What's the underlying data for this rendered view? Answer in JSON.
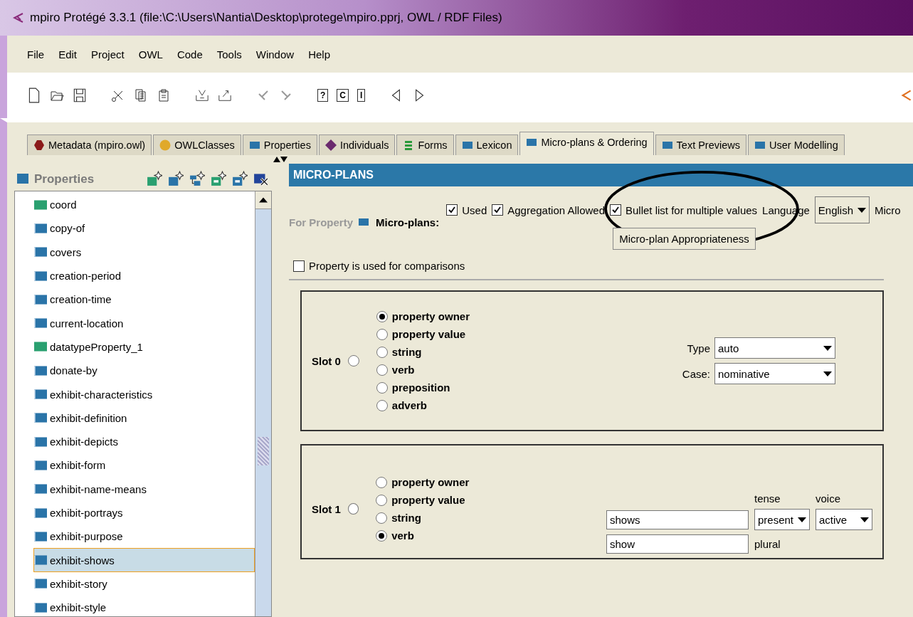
{
  "window": {
    "title": "mpiro  Protégé 3.3.1     (file:\\C:\\Users\\Nantia\\Desktop\\protege\\mpiro.pprj, OWL / RDF Files)"
  },
  "menu": [
    "File",
    "Edit",
    "Project",
    "OWL",
    "Code",
    "Tools",
    "Window",
    "Help"
  ],
  "toolbar": {
    "query_buttons": [
      "?",
      "C",
      "I"
    ]
  },
  "tabs": [
    {
      "label": "Metadata (mpiro.owl)",
      "kind": "metadata",
      "color": "#8b1a1a",
      "selected": false
    },
    {
      "label": "OWLClasses",
      "kind": "classes",
      "color": "#e0a92a",
      "selected": false
    },
    {
      "label": "Properties",
      "kind": "plugin",
      "color": "#2a74a8",
      "selected": false
    },
    {
      "label": "Individuals",
      "kind": "individuals",
      "color": "#6a2a6e",
      "selected": false
    },
    {
      "label": "Forms",
      "kind": "forms",
      "color": "#2a9a3a",
      "selected": false
    },
    {
      "label": "Lexicon",
      "kind": "plugin",
      "color": "#2a74a8",
      "selected": false
    },
    {
      "label": "Micro-plans & Ordering",
      "kind": "plugin",
      "color": "#2a74a8",
      "selected": true
    },
    {
      "label": "Text Previews",
      "kind": "plugin",
      "color": "#2a74a8",
      "selected": false
    },
    {
      "label": "User Modelling",
      "kind": "plugin",
      "color": "#2a74a8",
      "selected": false
    }
  ],
  "sidebar": {
    "title": "Properties",
    "items": [
      {
        "label": "coord",
        "kind": "datatype",
        "selected": false
      },
      {
        "label": "copy-of",
        "kind": "object",
        "selected": false
      },
      {
        "label": "covers",
        "kind": "object",
        "selected": false
      },
      {
        "label": "creation-period",
        "kind": "object",
        "selected": false
      },
      {
        "label": "creation-time",
        "kind": "object",
        "selected": false
      },
      {
        "label": "current-location",
        "kind": "object",
        "selected": false
      },
      {
        "label": "datatypeProperty_1",
        "kind": "datatype",
        "selected": false
      },
      {
        "label": "donate-by",
        "kind": "object",
        "selected": false
      },
      {
        "label": "exhibit-characteristics",
        "kind": "object",
        "selected": false
      },
      {
        "label": "exhibit-definition",
        "kind": "object",
        "selected": false
      },
      {
        "label": "exhibit-depicts",
        "kind": "object",
        "selected": false
      },
      {
        "label": "exhibit-form",
        "kind": "object",
        "selected": false
      },
      {
        "label": "exhibit-name-means",
        "kind": "object",
        "selected": false
      },
      {
        "label": "exhibit-portrays",
        "kind": "object",
        "selected": false
      },
      {
        "label": "exhibit-purpose",
        "kind": "object",
        "selected": false
      },
      {
        "label": "exhibit-shows",
        "kind": "object",
        "selected": true
      },
      {
        "label": "exhibit-story",
        "kind": "object",
        "selected": false
      },
      {
        "label": "exhibit-style",
        "kind": "object",
        "selected": false
      }
    ]
  },
  "micro_plans": {
    "header": "MICRO-PLANS",
    "for_property": "For Property",
    "micro_plans_label": "Micro-plans:",
    "checkboxes": [
      {
        "label": "Used",
        "checked": true
      },
      {
        "label": "Aggregation Allowed",
        "checked": true
      },
      {
        "label": "Bullet list for multiple values",
        "checked": true
      }
    ],
    "language_label": "Language",
    "language": "English",
    "trailing_label": "Micro",
    "appropriateness_button": "Micro-plan Appropriateness",
    "comparison": {
      "label": "Property is used for comparisons",
      "checked": false
    },
    "slots": [
      {
        "kind": "noun",
        "label": "Slot 0",
        "selected": false,
        "options": [
          {
            "label": "property owner",
            "selected": true
          },
          {
            "label": "property value",
            "selected": false
          },
          {
            "label": "string",
            "selected": false
          },
          {
            "label": "verb",
            "selected": false
          },
          {
            "label": "preposition",
            "selected": false
          },
          {
            "label": "adverb",
            "selected": false
          }
        ],
        "type_label": "Type",
        "type": "auto",
        "case_label": "Case:",
        "case": "nominative"
      },
      {
        "kind": "verb",
        "label": "Slot 1",
        "selected": false,
        "options": [
          {
            "label": "property owner",
            "selected": false
          },
          {
            "label": "property value",
            "selected": false
          },
          {
            "label": "string",
            "selected": false
          },
          {
            "label": "verb",
            "selected": true
          }
        ],
        "tense_label": "tense",
        "voice_label": "voice",
        "singular": "shows",
        "tense": "present",
        "voice": "active",
        "plural": "show",
        "plural_label": "plural"
      }
    ]
  }
}
